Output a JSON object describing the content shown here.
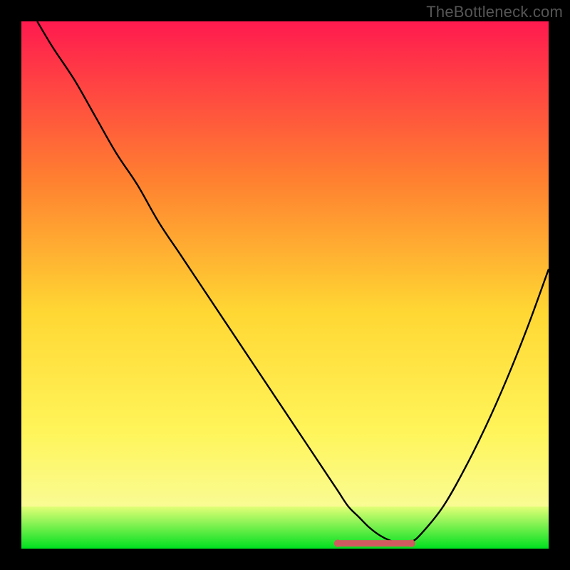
{
  "watermark": "TheBottleneck.com",
  "colors": {
    "page_bg": "#000000",
    "watermark_color": "#555555",
    "curve_stroke": "#000000",
    "green_line": "#00e020",
    "green_band_top": "#e3ff77",
    "green_band_bottom": "#00e020",
    "optimal_marker_stroke": "#cf5b60",
    "optimal_marker_fill": "#cf5b60",
    "gradient_top": "#ff1a4f",
    "gradient_mid1": "#ff8030",
    "gradient_mid2": "#ffd733",
    "gradient_mid3": "#fff55a",
    "gradient_bottom": "#f6ffb4"
  },
  "chart_data": {
    "type": "line",
    "title": "",
    "xlabel": "",
    "ylabel": "",
    "xlim": [
      0,
      100
    ],
    "ylim": [
      0,
      100
    ],
    "annotations": [],
    "series": [
      {
        "name": "bottleneck_curve",
        "x": [
          3,
          6,
          10,
          14,
          18,
          22,
          26,
          30,
          34,
          38,
          42,
          46,
          50,
          54,
          58,
          60,
          62,
          64,
          66,
          68,
          70,
          72,
          74,
          76,
          80,
          84,
          88,
          92,
          96,
          100
        ],
        "y": [
          100,
          95,
          89,
          82,
          75,
          69,
          62,
          56,
          50,
          44,
          38,
          32,
          26,
          20,
          14,
          11,
          8,
          6,
          4,
          2.5,
          1.5,
          1,
          1.3,
          3,
          8,
          15,
          23,
          32,
          42,
          53
        ]
      }
    ],
    "optimal_range_x": [
      60,
      74
    ],
    "green_band_y": [
      0,
      8
    ]
  }
}
